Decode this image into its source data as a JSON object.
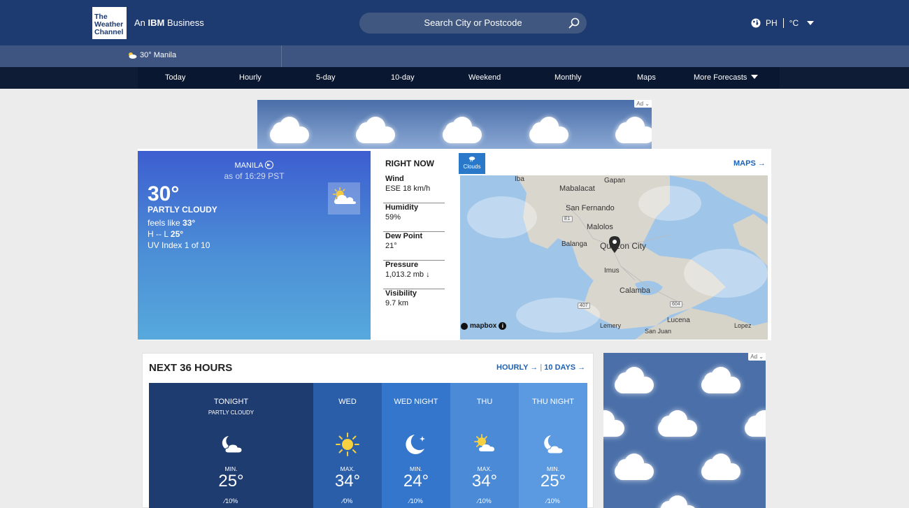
{
  "header": {
    "logo_lines": [
      "The",
      "Weather",
      "Channel"
    ],
    "tagline_pre": "An ",
    "tagline_brand": "IBM",
    "tagline_post": " Business",
    "search_placeholder": "Search City or Postcode",
    "country": "PH",
    "unit": "°C"
  },
  "recent_location": "30° Manila",
  "nav": [
    "Today",
    "Hourly",
    "5-day",
    "10-day",
    "Weekend",
    "Monthly",
    "Maps",
    "More Forecasts"
  ],
  "ad_label": "Ad",
  "current": {
    "location": "MANILA",
    "as_of": "as of 16:29 PST",
    "temp": "30°",
    "phrase": "PARTLY CLOUDY",
    "feels_label": "feels like ",
    "feels_value": "33°",
    "hl_label": "H -- L ",
    "hl_value": "25°",
    "uv": "UV Index 1 of 10"
  },
  "right_now": {
    "title": "RIGHT NOW",
    "items": [
      {
        "label": "Wind",
        "value": "ESE 18 km/h"
      },
      {
        "label": "Humidity",
        "value": "59%"
      },
      {
        "label": "Dew Point",
        "value": "21°"
      },
      {
        "label": "Pressure",
        "value": "1,013.2 mb ↓"
      },
      {
        "label": "Visibility",
        "value": "9.7 km"
      }
    ]
  },
  "map": {
    "layer_button": "Clouds",
    "maps_link": "MAPS →",
    "places": [
      "Iba",
      "Gapan",
      "Mabalacat",
      "San Fernando",
      "Malolos",
      "Balanga",
      "Quezon City",
      "Imus",
      "Calamba",
      "Lucena",
      "Lemery",
      "San Juan",
      "Lopez"
    ],
    "road_labels": [
      "E1",
      "407",
      "604"
    ],
    "attribution": "mapbox"
  },
  "next36": {
    "title": "NEXT 36 HOURS",
    "hourly_link": "HOURLY →",
    "days_link": "10 DAYS →",
    "periods": [
      {
        "name": "TONIGHT",
        "phrase": "PARTLY CLOUDY",
        "label": "MIN.",
        "temp": "25°",
        "precip": "10%",
        "icon": "partly-cloudy-night-icon",
        "color": "#1f3c70"
      },
      {
        "name": "WED",
        "phrase": "",
        "label": "MAX.",
        "temp": "34°",
        "precip": "0%",
        "icon": "sun-icon",
        "color": "#2a5ea9"
      },
      {
        "name": "WED NIGHT",
        "phrase": "",
        "label": "MIN.",
        "temp": "24°",
        "precip": "10%",
        "icon": "moon-stars-icon",
        "color": "#3376cc"
      },
      {
        "name": "THU",
        "phrase": "",
        "label": "MAX.",
        "temp": "34°",
        "precip": "10%",
        "icon": "partly-sunny-icon",
        "color": "#4a8ad6"
      },
      {
        "name": "THU NIGHT",
        "phrase": "",
        "label": "MIN.",
        "temp": "25°",
        "precip": "10%",
        "icon": "partly-cloudy-night-icon",
        "color": "#5b9ae0"
      }
    ]
  }
}
